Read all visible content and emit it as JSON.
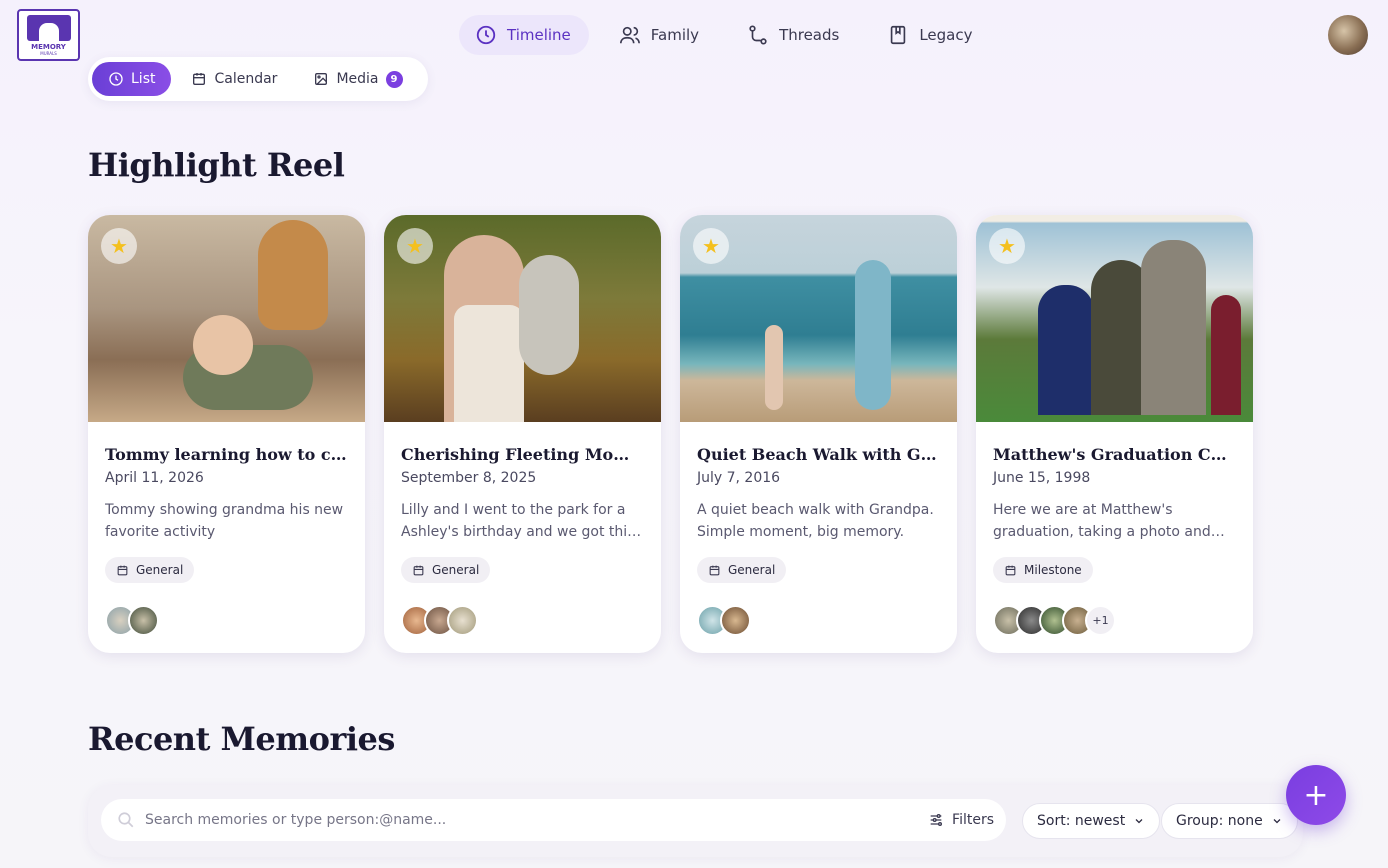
{
  "logo": {
    "line1": "MEMORY",
    "line2": "MURALS"
  },
  "topnav": [
    {
      "label": "Timeline",
      "icon": "clock-icon",
      "active": true
    },
    {
      "label": "Family",
      "icon": "users-icon",
      "active": false
    },
    {
      "label": "Threads",
      "icon": "route-icon",
      "active": false
    },
    {
      "label": "Legacy",
      "icon": "book-icon",
      "active": false
    }
  ],
  "subnav": {
    "list": "List",
    "calendar": "Calendar",
    "media": "Media",
    "media_count": "9"
  },
  "highlight": {
    "title": "Highlight Reel",
    "cards": [
      {
        "title": "Tommy learning how to crawl",
        "date": "April 11, 2026",
        "desc": "Tommy showing grandma his new favorite activity",
        "tag": "General",
        "people_extra": ""
      },
      {
        "title": "Cherishing Fleeting Moments",
        "date": "September 8, 2025",
        "desc": "Lilly and I went to the park for a Ashley's birthday and we got this nice picture together",
        "tag": "General",
        "people_extra": ""
      },
      {
        "title": "Quiet Beach Walk with Grandpa",
        "date": "July 7, 2016",
        "desc": "A quiet beach walk with Grandpa. Simple moment, big memory.",
        "tag": "General",
        "people_extra": ""
      },
      {
        "title": "Matthew's Graduation Celebration",
        "date": "June 15, 1998",
        "desc": "Here we are at Matthew's graduation, taking a photo and getting ready to celebrate",
        "tag": "Milestone",
        "people_extra": "+1"
      }
    ]
  },
  "recent": {
    "title": "Recent Memories",
    "search_placeholder": "Search memories or type person:@name...",
    "filters": "Filters",
    "sort": "Sort: newest",
    "group": "Group: none"
  },
  "fab": "+",
  "colors": {
    "accent": "#7b3fe0",
    "star": "#f4c01e"
  }
}
